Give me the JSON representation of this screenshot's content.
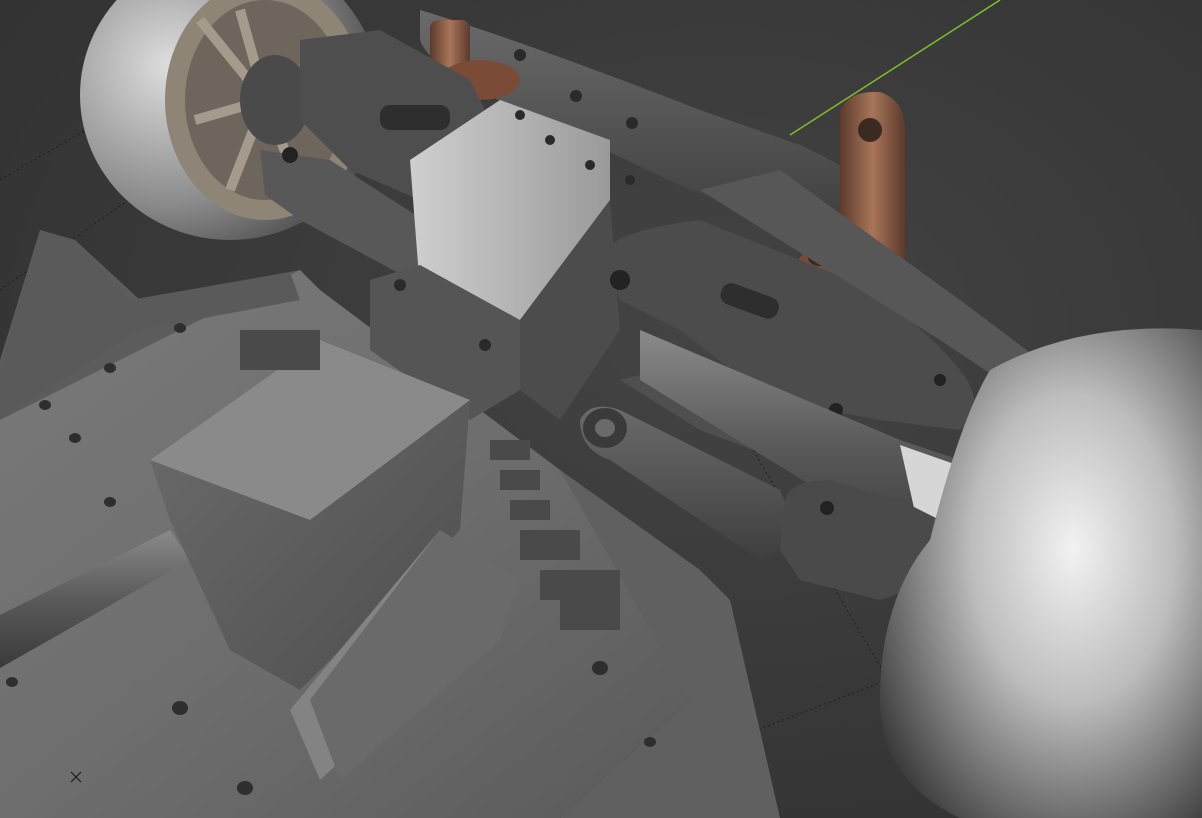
{
  "app": {
    "viewport_label": "",
    "render_mode": "solid",
    "view": "perspective"
  },
  "colors": {
    "background": "#3a3a3a",
    "metal_dark": "#4a4a4a",
    "metal_mid": "#6a6a6a",
    "metal_light": "#9a9a9a",
    "copper": "#8a5a44",
    "y_axis_line": "#7fbf2a",
    "tire": "#c8c8c8"
  },
  "icons": {
    "cursor": "3d-cursor-icon"
  }
}
